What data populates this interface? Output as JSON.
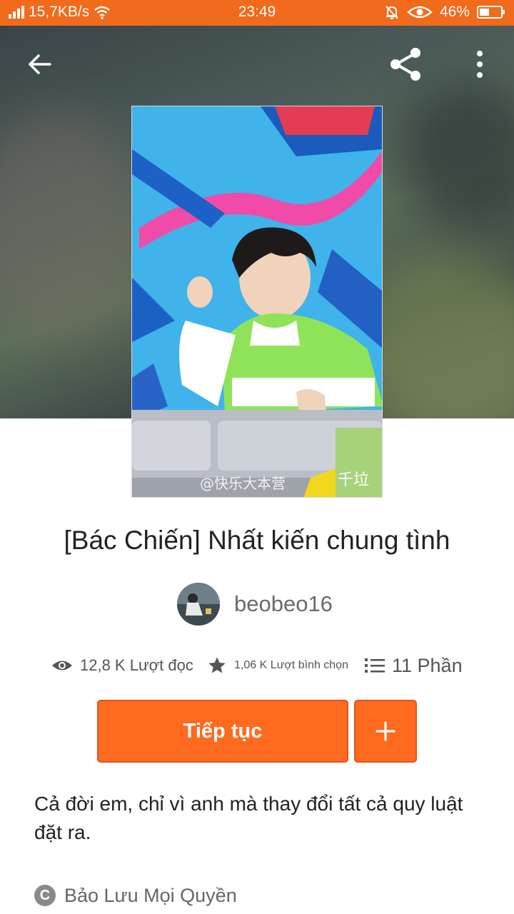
{
  "status_bar": {
    "network_speed": "15,7KB/s",
    "time": "23:49",
    "battery_percent": "46%",
    "battery_level": 0.46
  },
  "story": {
    "title": "[Bác Chiến] Nhất kiến chung tình",
    "author": "beobeo16",
    "cover_watermark": "@快乐大本营",
    "cover_sign_text": "千垃"
  },
  "stats": {
    "reads": "12,8 K Lượt đọc",
    "votes": "1,06 K Lượt bình chọn",
    "parts": "11 Phần"
  },
  "actions": {
    "continue_label": "Tiếp tục"
  },
  "description": "Cả đời em, chỉ vì anh mà thay đổi tất cả quy luật đặt ra.",
  "copyright": "Bảo Lưu Mọi Quyền",
  "colors": {
    "accent": "#fe6a1e",
    "status_bar": "#f26a1b"
  }
}
